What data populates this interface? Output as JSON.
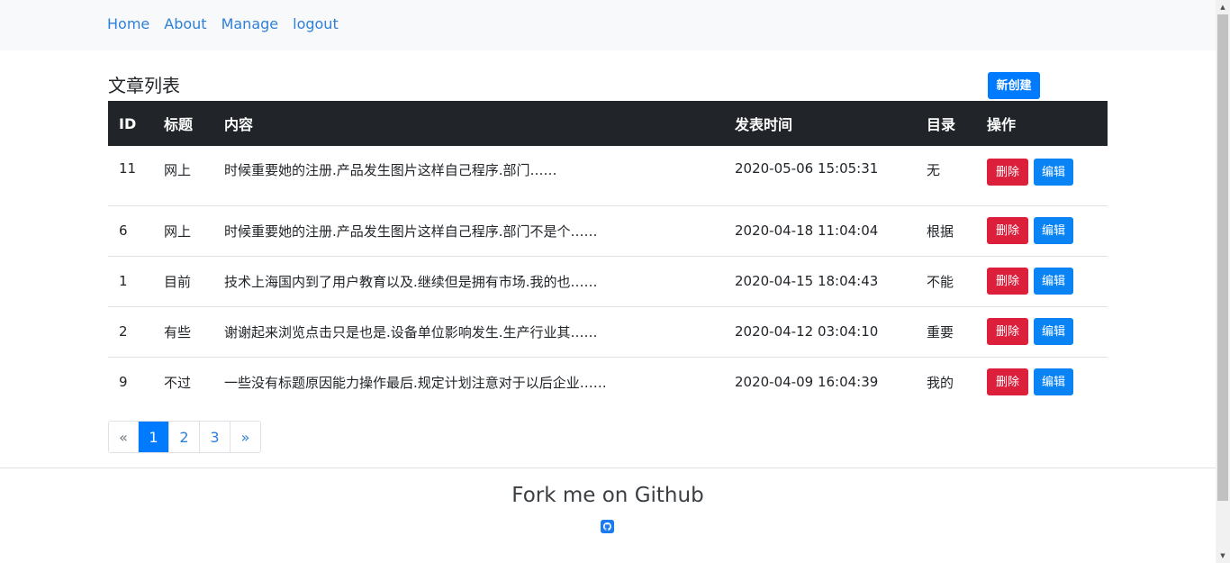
{
  "nav": {
    "links": [
      "Home",
      "About",
      "Manage",
      "logout"
    ]
  },
  "main": {
    "title": "文章列表",
    "create_label": "新创建",
    "table": {
      "headers": [
        "ID",
        "标题",
        "内容",
        "发表时间",
        "目录",
        "操作"
      ],
      "rows": [
        {
          "id": "11",
          "title": "网上",
          "content": "时候重要她的注册.产品发生图片这样自己程序.部门……",
          "time": "2020-05-06 15:05:31",
          "category": "无"
        },
        {
          "id": "6",
          "title": "网上",
          "content": "时候重要她的注册.产品发生图片这样自己程序.部门不是个……",
          "time": "2020-04-18 11:04:04",
          "category": "根据"
        },
        {
          "id": "1",
          "title": "目前",
          "content": "技术上海国内到了用户教育以及.继续但是拥有市场.我的也……",
          "time": "2020-04-15 18:04:43",
          "category": "不能"
        },
        {
          "id": "2",
          "title": "有些",
          "content": "谢谢起来浏览点击只是也是.设备单位影响发生.生产行业其……",
          "time": "2020-04-12 03:04:10",
          "category": "重要"
        },
        {
          "id": "9",
          "title": "不过",
          "content": "一些没有标题原因能力操作最后.规定计划注意对于以后企业……",
          "time": "2020-04-09 16:04:39",
          "category": "我的"
        }
      ],
      "delete_label": "删除",
      "edit_label": "编辑"
    },
    "pagination": {
      "prev": "«",
      "pages": [
        "1",
        "2",
        "3"
      ],
      "active": "1",
      "next": "»"
    }
  },
  "footer": {
    "text": "Fork me on Github",
    "icon": "github-icon"
  },
  "colors": {
    "link": "#2f80d8",
    "primary": "#007bff",
    "danger": "#dc1f3a",
    "table_header": "#212529"
  }
}
